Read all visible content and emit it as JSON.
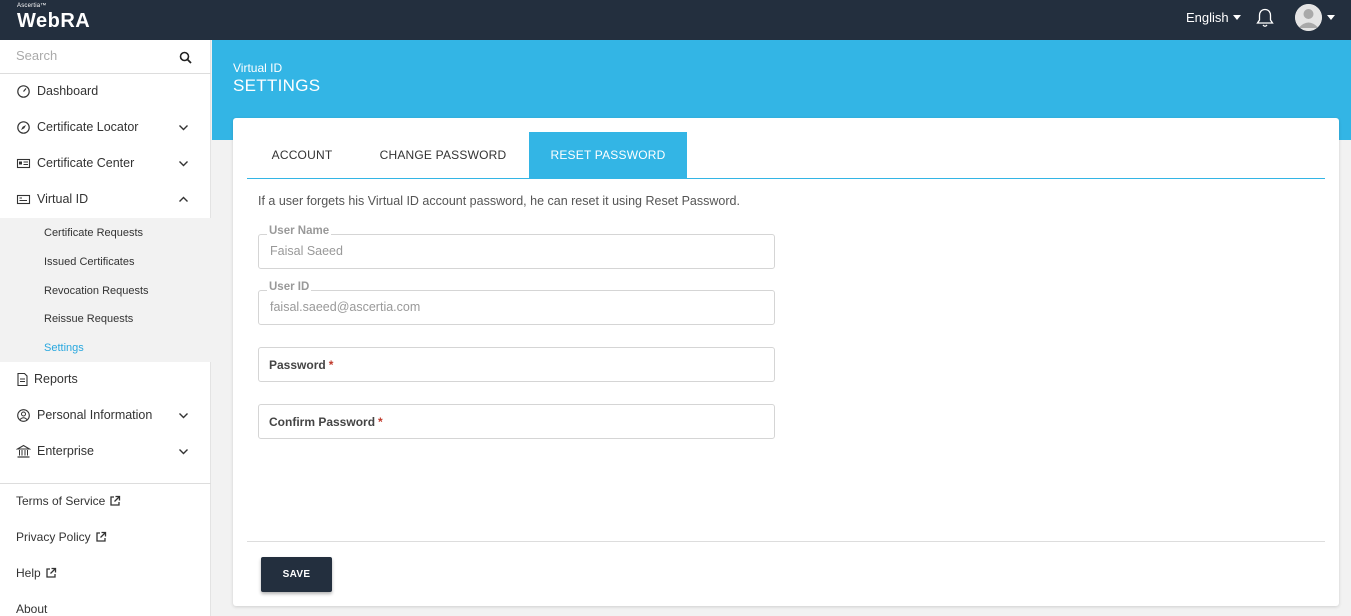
{
  "app": {
    "brand": "Ascertia™",
    "name": "WebRA"
  },
  "topbar": {
    "language": "English"
  },
  "sidebar": {
    "search_placeholder": "Search",
    "items": [
      {
        "label": "Dashboard",
        "icon": "dashboard-icon"
      },
      {
        "label": "Certificate Locator",
        "icon": "compass-icon"
      },
      {
        "label": "Certificate Center",
        "icon": "id-card-icon"
      },
      {
        "label": "Virtual ID",
        "icon": "virtual-id-icon"
      },
      {
        "label": "Reports",
        "icon": "document-icon"
      },
      {
        "label": "Personal Information",
        "icon": "user-circle-icon"
      },
      {
        "label": "Enterprise",
        "icon": "bank-icon"
      }
    ],
    "submenu": [
      {
        "label": "Certificate Requests"
      },
      {
        "label": "Issued Certificates"
      },
      {
        "label": "Revocation Requests"
      },
      {
        "label": "Reissue Requests"
      },
      {
        "label": "Settings"
      }
    ],
    "footer": [
      {
        "label": "Terms of Service"
      },
      {
        "label": "Privacy Policy"
      },
      {
        "label": "Help"
      },
      {
        "label": "About"
      }
    ]
  },
  "header": {
    "subtitle": "Virtual ID",
    "title": "SETTINGS"
  },
  "tabs": [
    {
      "label": "ACCOUNT"
    },
    {
      "label": "CHANGE PASSWORD"
    },
    {
      "label": "RESET PASSWORD"
    }
  ],
  "form": {
    "info": "If a user forgets his Virtual ID account password, he can reset it using Reset Password.",
    "username_label": "User Name",
    "username_value": "Faisal Saeed",
    "userid_label": "User ID",
    "userid_value": "faisal.saeed@ascertia.com",
    "password_label": "Password",
    "confirm_label": "Confirm Password",
    "required_mark": "*",
    "save_label": "SAVE"
  },
  "colors": {
    "accent": "#33b5e5",
    "topbar": "#232f3e",
    "active_link": "#29a8df"
  }
}
